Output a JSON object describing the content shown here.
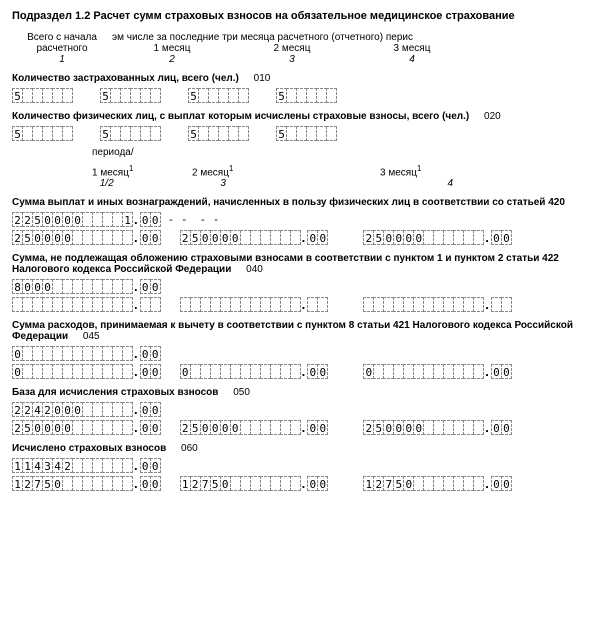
{
  "title": "Подраздел 1.2 Расчет сумм страховых взносов на обязательное медицинское страхование",
  "colHeaders": {
    "c1a": "Всего с начала",
    "c1b": "расчетного",
    "colspan": "эм числе за последние три месяца расчетного (отчетного) перис",
    "m1": "1 месяц",
    "m2": "2 месяц",
    "m3": "3 месяц",
    "s1": "1",
    "s2": "2",
    "s3": "3",
    "s4": "4"
  },
  "row010": {
    "label": "Количество застрахованных лиц, всего (чел.)",
    "code": "010",
    "v1": "5",
    "v2": "5",
    "v3": "5",
    "v4": "5"
  },
  "row020": {
    "label": "Количество физических лиц, с выплат которым исчислены страховые взносы, всего (чел.)",
    "code": "020",
    "v1": "5",
    "v2": "5",
    "v3": "5",
    "v4": "5"
  },
  "periodHdr": {
    "p0": "периода/",
    "p1a": "1 месяц",
    "p2a": "2 месяц",
    "p3a": "3 месяц",
    "sup": "1",
    "s1": "1/2",
    "s2": "3",
    "s3": "4"
  },
  "row030": {
    "label": "Сумма выплат и иных вознаграждений, начисленных в пользу физических лиц в соответствии со статьей 420",
    "top_int": [
      "2",
      "2",
      "5",
      "0",
      "0",
      "0",
      "0",
      "",
      "",
      "",
      "",
      "1"
    ],
    "top_dec": [
      "0",
      "0"
    ],
    "b1_int": [
      "2",
      "5",
      "0",
      "0",
      "0",
      "0",
      "",
      "",
      "",
      "",
      "",
      ""
    ],
    "b1_dec": [
      "0",
      "0"
    ],
    "b2_int": [
      "2",
      "5",
      "0",
      "0",
      "0",
      "0",
      "",
      "",
      "",
      "",
      "",
      ""
    ],
    "b2_dec": [
      "0",
      "0"
    ],
    "b3_int": [
      "2",
      "5",
      "0",
      "0",
      "0",
      "0",
      "",
      "",
      "",
      "",
      "",
      ""
    ],
    "b3_dec": [
      "0",
      "0"
    ]
  },
  "row040": {
    "label": "Сумма, не подлежащая обложению страховыми взносами в соответствии с пунктом 1 и пунктом 2 статьи 422 Налогового кодекса Российской Федерации",
    "code": "040",
    "top_int": [
      "8",
      "0",
      "0",
      "0",
      "",
      "",
      "",
      "",
      "",
      "",
      "",
      ""
    ],
    "top_dec": [
      "0",
      "0"
    ],
    "b1_int": [
      "",
      "",
      "",
      "",
      "",
      "",
      "",
      "",
      "",
      "",
      "",
      ""
    ],
    "b1_dec": [
      "",
      ""
    ],
    "b2_int": [
      "",
      "",
      "",
      "",
      "",
      "",
      "",
      "",
      "",
      "",
      "",
      ""
    ],
    "b2_dec": [
      "",
      ""
    ],
    "b3_int": [
      "",
      "",
      "",
      "",
      "",
      "",
      "",
      "",
      "",
      "",
      "",
      ""
    ],
    "b3_dec": [
      "",
      ""
    ]
  },
  "row045": {
    "label": "Сумма расходов, принимаемая к вычету в соответствии с пунктом 8 статьи 421 Налогового кодекса Российской Федерации",
    "code": "045",
    "top_int": [
      "0",
      "",
      "",
      "",
      "",
      "",
      "",
      "",
      "",
      "",
      "",
      ""
    ],
    "top_dec": [
      "0",
      "0"
    ],
    "b1_int": [
      "0",
      "",
      "",
      "",
      "",
      "",
      "",
      "",
      "",
      "",
      "",
      ""
    ],
    "b1_dec": [
      "0",
      "0"
    ],
    "b2_int": [
      "0",
      "",
      "",
      "",
      "",
      "",
      "",
      "",
      "",
      "",
      "",
      ""
    ],
    "b2_dec": [
      "0",
      "0"
    ],
    "b3_int": [
      "0",
      "",
      "",
      "",
      "",
      "",
      "",
      "",
      "",
      "",
      "",
      ""
    ],
    "b3_dec": [
      "0",
      "0"
    ]
  },
  "row050": {
    "label": "База для исчисления страховых взносов",
    "code": "050",
    "top_int": [
      "2",
      "2",
      "4",
      "2",
      "0",
      "0",
      "0",
      "",
      "",
      "",
      "",
      ""
    ],
    "top_dec": [
      "0",
      "0"
    ],
    "b1_int": [
      "2",
      "5",
      "0",
      "0",
      "0",
      "0",
      "",
      "",
      "",
      "",
      "",
      ""
    ],
    "b1_dec": [
      "0",
      "0"
    ],
    "b2_int": [
      "2",
      "5",
      "0",
      "0",
      "0",
      "0",
      "",
      "",
      "",
      "",
      "",
      ""
    ],
    "b2_dec": [
      "0",
      "0"
    ],
    "b3_int": [
      "2",
      "5",
      "0",
      "0",
      "0",
      "0",
      "",
      "",
      "",
      "",
      "",
      ""
    ],
    "b3_dec": [
      "0",
      "0"
    ]
  },
  "row060": {
    "label": "Исчислено страховых взносов",
    "code": "060",
    "top_int": [
      "1",
      "1",
      "4",
      "3",
      "4",
      "2",
      "",
      "",
      "",
      "",
      "",
      ""
    ],
    "top_dec": [
      "0",
      "0"
    ],
    "b1_int": [
      "1",
      "2",
      "7",
      "5",
      "0",
      "",
      "",
      "",
      "",
      "",
      "",
      ""
    ],
    "b1_dec": [
      "0",
      "0"
    ],
    "b2_int": [
      "1",
      "2",
      "7",
      "5",
      "0",
      "",
      "",
      "",
      "",
      "",
      "",
      ""
    ],
    "b2_dec": [
      "0",
      "0"
    ],
    "b3_int": [
      "1",
      "2",
      "7",
      "5",
      "0",
      "",
      "",
      "",
      "",
      "",
      "",
      ""
    ],
    "b3_dec": [
      "0",
      "0"
    ]
  },
  "dot": "."
}
